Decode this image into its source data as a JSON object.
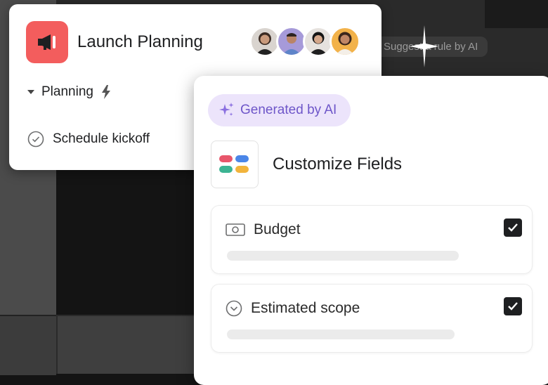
{
  "project": {
    "title": "Launch Planning",
    "icon": "megaphone-icon",
    "icon_color": "#f35d5d"
  },
  "members": [
    {
      "name": "member-1",
      "bg": "#d9d4cf"
    },
    {
      "name": "member-2",
      "bg": "#a69ad9"
    },
    {
      "name": "member-3",
      "bg": "#e6e2de"
    },
    {
      "name": "member-4",
      "bg": "#f2b24a"
    }
  ],
  "section": {
    "label": "Planning",
    "icon": "lightning-icon"
  },
  "task": {
    "label": "Schedule kickoff",
    "icon": "check-circle-icon"
  },
  "background": {
    "ghost_label": "Suggest a rule by AI"
  },
  "ai_panel": {
    "badge_label": "Generated by AI",
    "badge_icon": "sparkle-icon",
    "title": "Customize Fields",
    "fields": [
      {
        "label": "Budget",
        "icon": "currency-icon",
        "checked": true
      },
      {
        "label": "Estimated scope",
        "icon": "chevron-circle-icon",
        "checked": true
      }
    ]
  }
}
